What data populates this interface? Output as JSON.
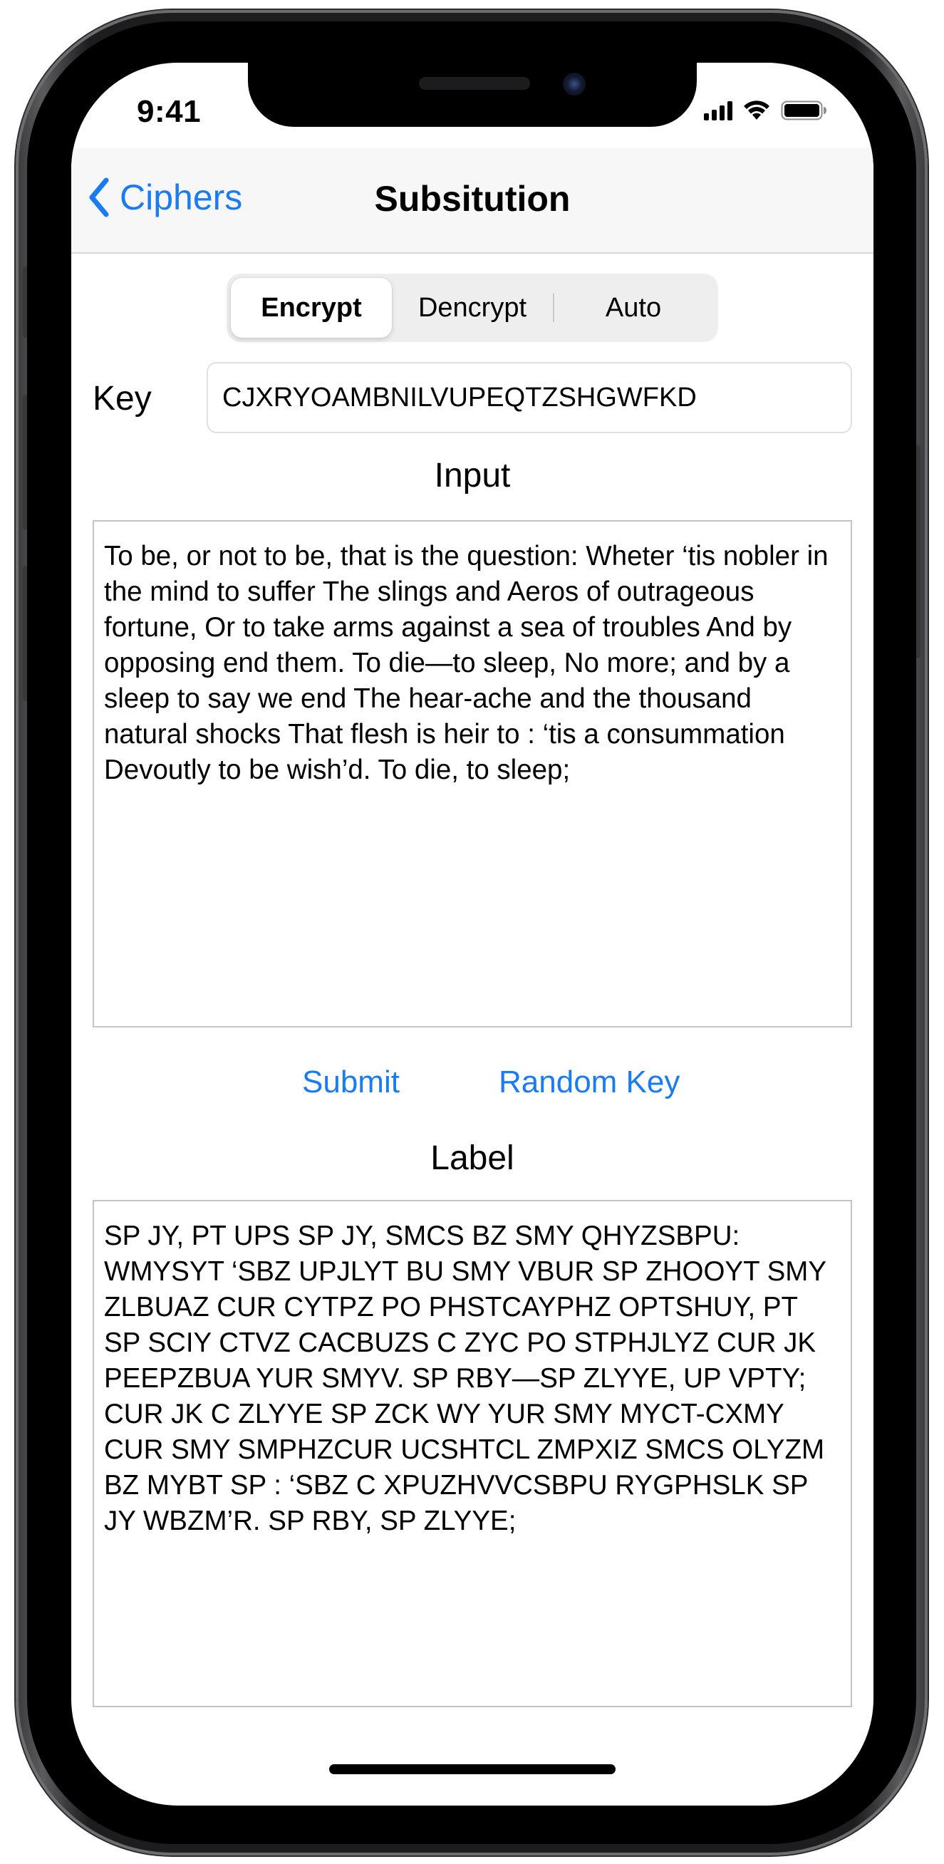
{
  "status_bar": {
    "time": "9:41"
  },
  "nav": {
    "back_label": "Ciphers",
    "title": "Subsitution"
  },
  "mode": {
    "segments": [
      "Encrypt",
      "Dencrypt",
      "Auto"
    ],
    "selected": "Encrypt"
  },
  "key": {
    "label": "Key",
    "value": "CJXRYOAMBNILVUPEQTZSHGWFKD"
  },
  "input": {
    "heading": "Input",
    "text": "To be, or not to be, that is the question: Wheter ‘tis nobler in the mind to suffer The slings and Aeros of outrageous fortune, Or to take arms against a sea of troubles And by opposing end them. To die—to sleep, No more; and by a sleep to say we end The hear-ache and the thousand natural shocks That flesh is heir to : ‘tis a consummation Devoutly to be wish’d. To die, to sleep;"
  },
  "actions": {
    "submit_label": "Submit",
    "random_key_label": "Random Key"
  },
  "output": {
    "heading": "Label",
    "text": "SP JY, PT UPS SP JY, SMCS BZ SMY QHYZSBPU: WMYSYT ‘SBZ UPJLYT BU SMY VBUR SP ZHOOYT SMY ZLBUAZ CUR CYTPZ PO PHSTCAYPHZ OPTSHUY, PT SP SCIY CTVZ CACBUZS C ZYC PO STPHJLYZ CUR JK PEEPZBUA YUR SMYV. SP RBY—SP ZLYYE, UP VPTY; CUR JK C ZLYYE SP ZCK WY YUR SMY MYCT-CXMY CUR SMY SMPHZCUR UCSHTCL ZMPXIZ SMCS OLYZM BZ MYBT SP : ‘SBZ C XPUZHVVCSBPU RYGPHSLK SP JY WBZM’R. SP RBY, SP ZLYYE;"
  },
  "colors": {
    "accent": "#1a7cf0",
    "nav_background": "#f7f7f7",
    "segmented_background": "#eeeeef"
  }
}
